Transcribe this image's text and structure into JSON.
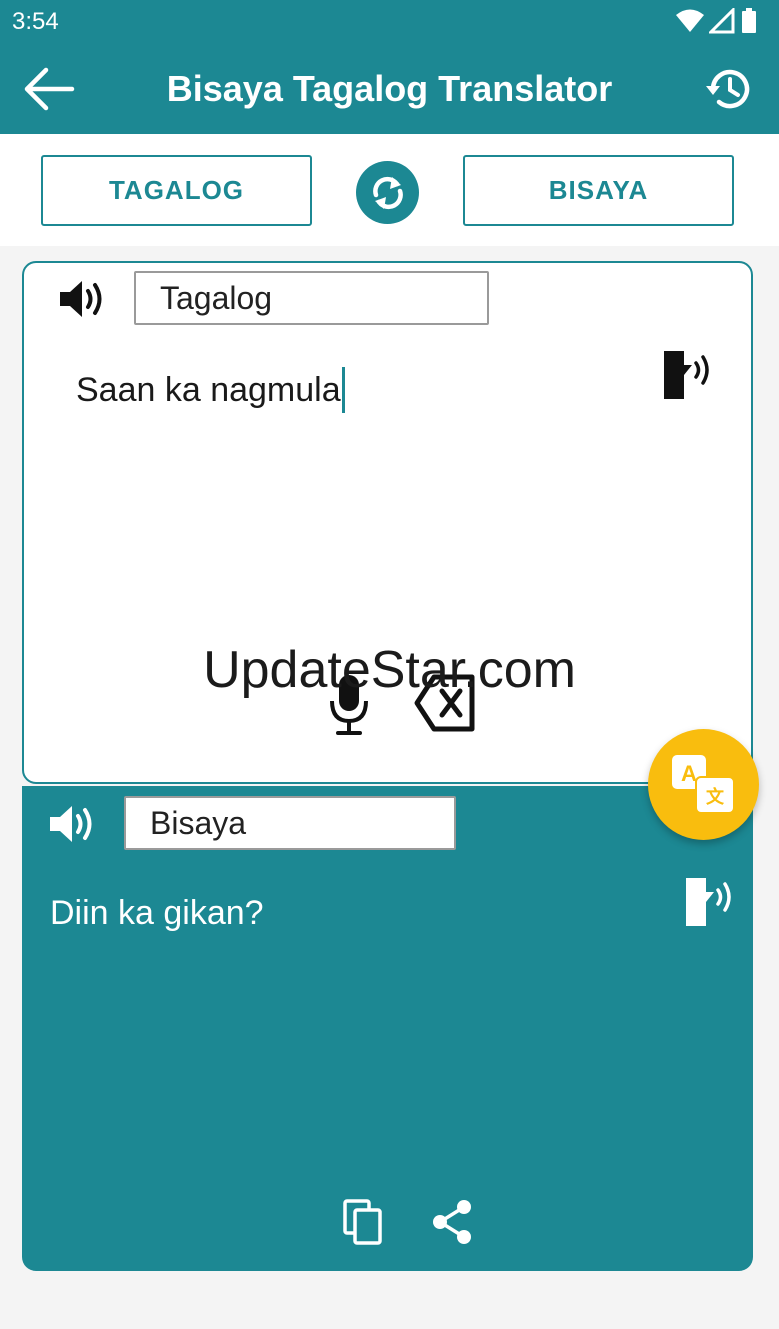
{
  "status_bar": {
    "time": "3:54"
  },
  "app_bar": {
    "title": "Bisaya Tagalog Translator"
  },
  "languages": {
    "source_button": "TAGALOG",
    "target_button": "BISAYA"
  },
  "source": {
    "label": "Tagalog",
    "text": "Saan ka nagmula"
  },
  "target": {
    "label": "Bisaya",
    "text": "Diin ka gikan?"
  },
  "watermark": "UpdateStar.com",
  "colors": {
    "primary": "#1c8893",
    "accent": "#f9bd0e",
    "background": "#f4f4f4"
  },
  "icons": {
    "back": "arrow-left-icon",
    "history": "history-icon",
    "swap": "swap-icon",
    "speaker": "speaker-icon",
    "tts": "text-to-speech-icon",
    "mic": "microphone-icon",
    "clear": "backspace-icon",
    "copy": "copy-icon",
    "share": "share-icon",
    "translate": "translate-icon"
  }
}
